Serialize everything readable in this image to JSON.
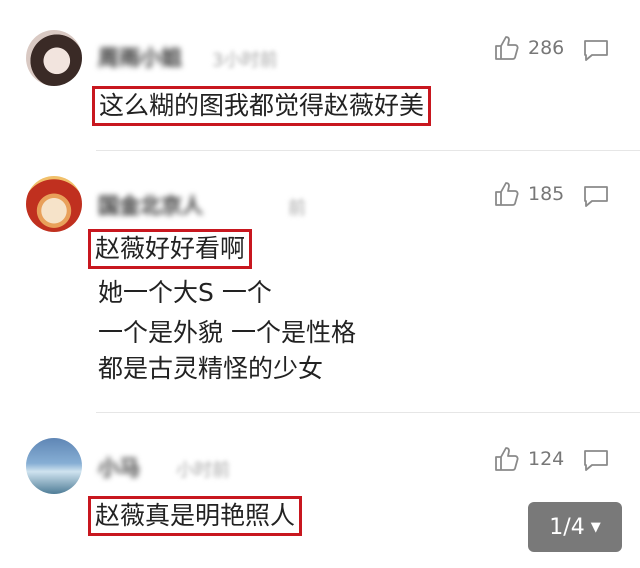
{
  "comments": [
    {
      "username": "周雨小姐",
      "time": "3小时前",
      "likes": "286",
      "lines": [
        "这么糊的图我都觉得赵薇好美"
      ]
    },
    {
      "username": "国金北京人",
      "time": "前",
      "likes": "185",
      "lines": [
        "赵薇好好看啊",
        "她一个大S 一个",
        "一个是外貌 一个是性格",
        "都是古灵精怪的少女"
      ]
    },
    {
      "username": "小马",
      "time": "小时前",
      "likes": "124",
      "lines": [
        "赵薇真是明艳照人"
      ]
    }
  ],
  "pager": {
    "label": "1/4",
    "caret": "▼"
  },
  "colors": {
    "highlight_box": "#c8171f",
    "pager_bg": "#6e6e6e"
  },
  "icons": {
    "like": "thumbs-up-icon",
    "reply": "comment-bubble-icon"
  }
}
